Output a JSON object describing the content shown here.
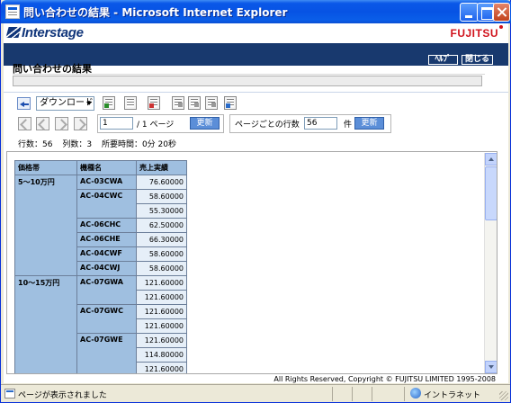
{
  "window": {
    "title": "問い合わせの結果 - Microsoft Internet Explorer"
  },
  "brand": {
    "product": "Interstage",
    "vendor": "FUJITSU"
  },
  "topnav": {
    "help_label": "ﾍﾙﾌﾟ",
    "close_label": "閉じる"
  },
  "page": {
    "title": "問い合わせの結果"
  },
  "toolbar": {
    "download_label": "ダウンロード",
    "icons": [
      "csv-export-icon",
      "print-preview-icon",
      "pdf-export-icon",
      "graph-icon-1",
      "graph-icon-2",
      "graph-icon-3",
      "excel-export-icon"
    ]
  },
  "paging": {
    "current_page": "1",
    "total_pages": "/ 1 ページ",
    "update_label": "更新",
    "rows_per_page_label": "ページごとの行数",
    "rows_per_page": "56",
    "rows_unit": "件",
    "update_label_2": "更新"
  },
  "stats": {
    "rows": "行数：56",
    "columns": "列数：3",
    "elapsed": "所要時間：0分 20秒"
  },
  "report": {
    "headers": [
      "価格帯",
      "機種名",
      "売上実績"
    ],
    "rows": [
      {
        "group": "5～10万円",
        "model": "AC-03CWA",
        "value": "76.60000"
      },
      {
        "group": "",
        "model": "AC-04CWC",
        "value": "58.60000"
      },
      {
        "group": "",
        "model": "",
        "value": "55.30000"
      },
      {
        "group": "",
        "model": "AC-06CHC",
        "value": "62.50000"
      },
      {
        "group": "",
        "model": "AC-06CHE",
        "value": "66.30000"
      },
      {
        "group": "",
        "model": "AC-04CWF",
        "value": "58.60000"
      },
      {
        "group": "",
        "model": "AC-04CWJ",
        "value": "58.60000"
      },
      {
        "group": "10～15万円",
        "model": "AC-07GWA",
        "value": "121.60000"
      },
      {
        "group": "",
        "model": "",
        "value": "121.60000"
      },
      {
        "group": "",
        "model": "AC-07GWC",
        "value": "121.60000"
      },
      {
        "group": "",
        "model": "",
        "value": "121.60000"
      },
      {
        "group": "",
        "model": "AC-07GWE",
        "value": "121.60000"
      },
      {
        "group": "",
        "model": "",
        "value": "114.80000"
      },
      {
        "group": "",
        "model": "",
        "value": "121.60000"
      }
    ]
  },
  "footer": {
    "copyright": "All Rights Reserved, Copyright © FUJITSU LIMITED 1995-2008"
  },
  "statusbar": {
    "text": "ページが表示されました",
    "zone": "イントラネット"
  }
}
